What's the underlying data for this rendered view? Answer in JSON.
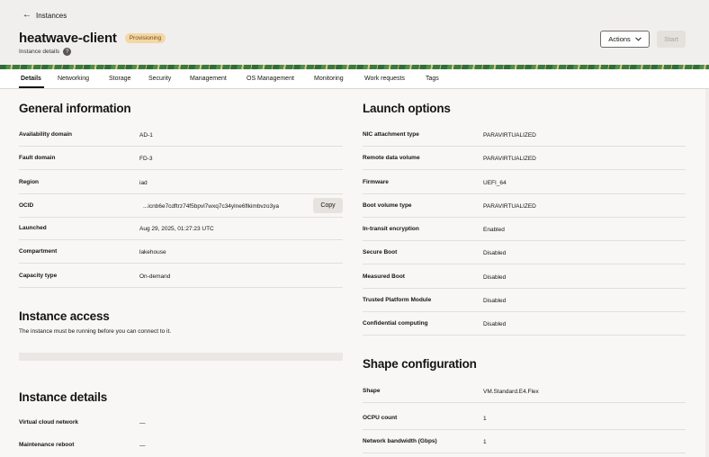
{
  "header": {
    "back_label": "Instances",
    "title": "heatwave-client",
    "status": "Provisioning",
    "subtitle": "Instance details",
    "help_icon": "?",
    "actions_label": "Actions",
    "start_label": "Start"
  },
  "tabs": [
    "Details",
    "Networking",
    "Storage",
    "Security",
    "Management",
    "OS Management",
    "Monitoring",
    "Work requests",
    "Tags"
  ],
  "general": {
    "title": "General information",
    "rows": [
      {
        "label": "Availability domain",
        "value": "AD-1"
      },
      {
        "label": "Fault domain",
        "value": "FD-3"
      },
      {
        "label": "Region",
        "value": "iad"
      },
      {
        "label": "OCID",
        "value": "...icnb6e7cdftrz74f5bpvl7wxq7c34ylne6flkimbvzo3ya"
      },
      {
        "label": "Launched",
        "value": "Aug 29, 2025, 01:27:23 UTC"
      },
      {
        "label": "Compartment",
        "value": "lakehouse"
      },
      {
        "label": "Capacity type",
        "value": "On-demand"
      }
    ],
    "copy_label": "Copy"
  },
  "access": {
    "title": "Instance access",
    "note": "The instance must be running before you can connect to it."
  },
  "instance_details": {
    "title": "Instance details",
    "rows": [
      {
        "label": "Virtual cloud network",
        "value": "—"
      },
      {
        "label": "Maintenance reboot",
        "value": "—"
      }
    ]
  },
  "launch": {
    "title": "Launch options",
    "rows": [
      {
        "label": "NIC attachment type",
        "value": "PARAVIRTUALIZED"
      },
      {
        "label": "Remote data volume",
        "value": "PARAVIRTUALIZED"
      },
      {
        "label": "Firmware",
        "value": "UEFI_64"
      },
      {
        "label": "Boot volume type",
        "value": "PARAVIRTUALIZED"
      },
      {
        "label": "In-transit encryption",
        "value": "Enabled"
      },
      {
        "label": "Secure Boot",
        "value": "Disabled"
      },
      {
        "label": "Measured Boot",
        "value": "Disabled"
      },
      {
        "label": "Trusted Platform Module",
        "value": "Disabled"
      },
      {
        "label": "Confidential computing",
        "value": "Disabled"
      }
    ]
  },
  "shape": {
    "title": "Shape configuration",
    "rows": [
      {
        "label": "Shape",
        "value": "VM.Standard.E4.Flex"
      },
      {
        "label": "OCPU count",
        "value": "1"
      },
      {
        "label": "Network bandwidth (Gbps)",
        "value": "1"
      }
    ]
  }
}
